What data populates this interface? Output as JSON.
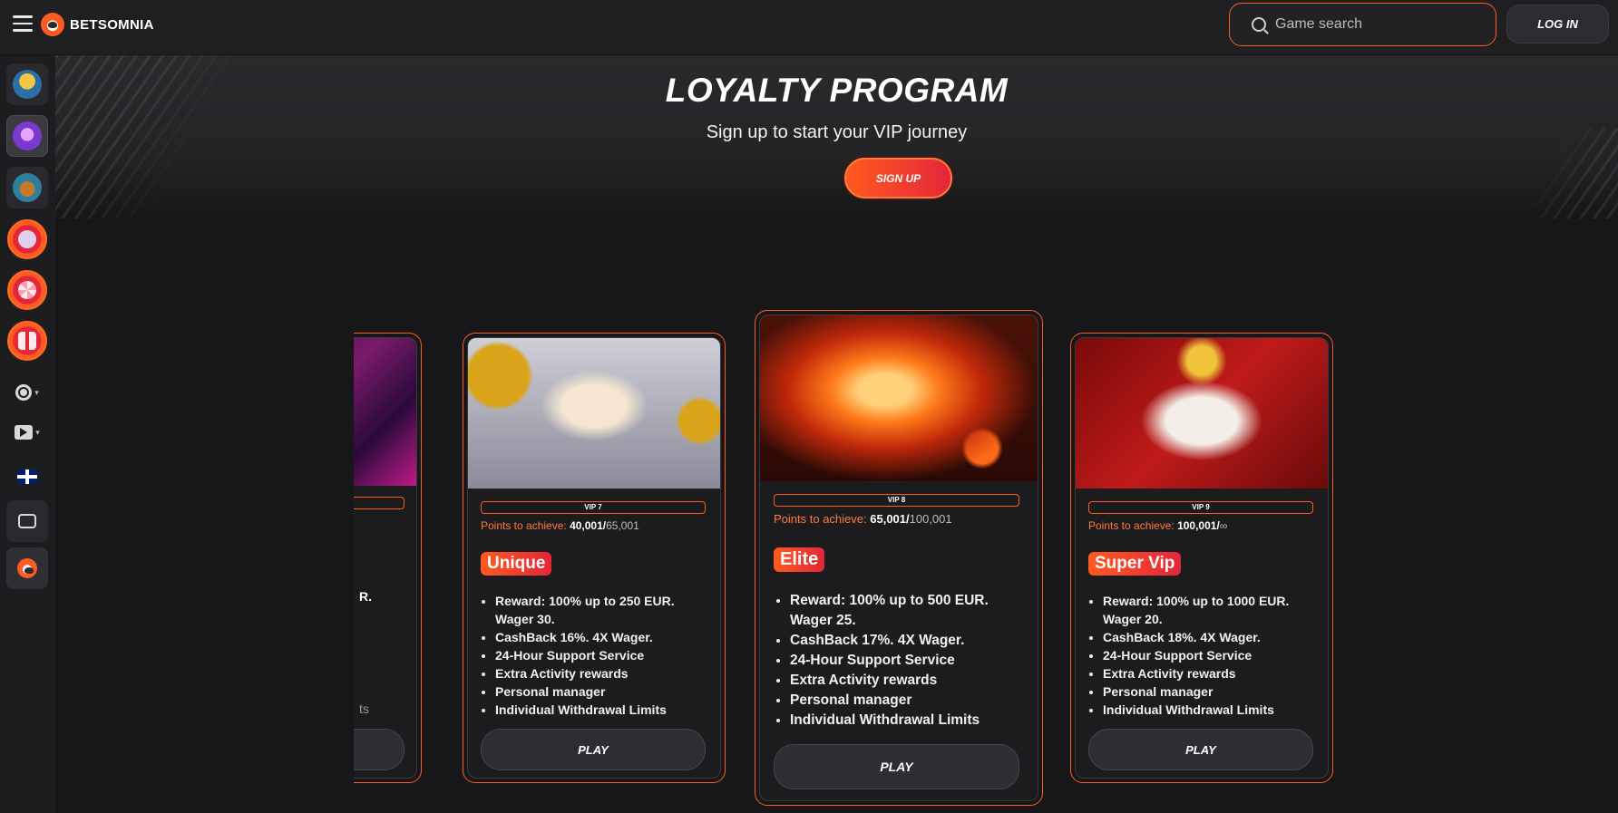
{
  "header": {
    "brand": "BETSOMNIA",
    "search_placeholder": "Game search",
    "login_label": "LOG IN"
  },
  "sidebar": {
    "items": [
      {
        "icon": "trophy-icon"
      },
      {
        "icon": "gem-icon"
      },
      {
        "icon": "treasure-icon"
      },
      {
        "icon": "poker-icon"
      },
      {
        "icon": "wheel-icon"
      },
      {
        "icon": "gift-icon"
      },
      {
        "icon": "settings-icon"
      },
      {
        "icon": "video-icon"
      },
      {
        "icon": "uk-flag-icon"
      },
      {
        "icon": "chat-icon"
      },
      {
        "icon": "brand-icon"
      }
    ]
  },
  "hero": {
    "title": "LOYALTY PROGRAM",
    "subtitle": "Sign up to start your VIP journey",
    "signup_label": "SIGN UP"
  },
  "cards": [
    {
      "partial": true,
      "benefit_fragment": "R.",
      "limits_fragment": "ts"
    },
    {
      "vip": "VIP 7",
      "points_label": "Points to achieve:",
      "points_min": "40,001/",
      "points_max": "65,001",
      "tier": "Unique",
      "benefits": [
        "Reward: 100% up to 250 EUR. Wager 30.",
        "CashBack 16%. 4X Wager.",
        "24-Hour Support Service",
        "Extra Activity rewards",
        "Personal manager",
        "Individual Withdrawal Limits"
      ],
      "play_label": "PLAY"
    },
    {
      "vip": "VIP 8",
      "points_label": "Points to achieve:",
      "points_min": "65,001/",
      "points_max": "100,001",
      "tier": "Elite",
      "benefits": [
        "Reward: 100% up to 500 EUR. Wager 25.",
        "CashBack 17%. 4X Wager.",
        "24-Hour Support Service",
        "Extra Activity rewards",
        "Personal manager",
        "Individual Withdrawal Limits"
      ],
      "play_label": "PLAY"
    },
    {
      "vip": "VIP 9",
      "points_label": "Points to achieve:",
      "points_min": "100,001/",
      "points_max": "∞",
      "tier": "Super Vip",
      "benefits": [
        "Reward: 100% up to 1000 EUR. Wager 20.",
        "CashBack 18%. 4X Wager.",
        "24-Hour Support Service",
        "Extra Activity rewards",
        "Personal manager",
        "Individual Withdrawal Limits"
      ],
      "play_label": "PLAY"
    }
  ]
}
